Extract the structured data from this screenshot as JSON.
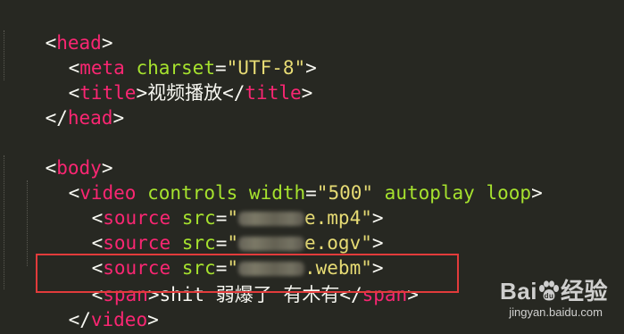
{
  "code": {
    "line1": {
      "tag": "head"
    },
    "line2": {
      "tag": "meta",
      "attr": "charset",
      "value": "\"UTF-8\""
    },
    "line3": {
      "open_tag": "title",
      "text": "视频播放",
      "close_tag": "title"
    },
    "line4": {
      "tag": "head"
    },
    "line6": {
      "tag": "body"
    },
    "line7": {
      "tag": "video",
      "attr1": "controls",
      "attr2": "width",
      "value2": "\"500\"",
      "attr3": "autoplay",
      "attr4": "loop"
    },
    "line8": {
      "tag": "source",
      "attr": "src",
      "quote_open": "\"",
      "visible_suffix": "e.mp4\""
    },
    "line9": {
      "tag": "source",
      "attr": "src",
      "quote_open": "\"",
      "visible_suffix": "e.ogv\""
    },
    "line10": {
      "tag": "source",
      "attr": "src",
      "quote_open": "\"",
      "visible_suffix": ".webm\""
    },
    "line11": {
      "open_tag": "span",
      "text": "shit 弱爆了 有木有",
      "close_tag": "span"
    },
    "line12": {
      "tag": "video"
    }
  },
  "watermark": {
    "logo_text_left": "Bai",
    "logo_text_right": "经验",
    "url": "jingyan.baidu.com"
  },
  "colors": {
    "background": "#272822",
    "tag": "#f92672",
    "attribute": "#a6e22e",
    "string": "#e6db74",
    "text": "#f8f8f2",
    "highlight_border": "#e23b3b"
  }
}
